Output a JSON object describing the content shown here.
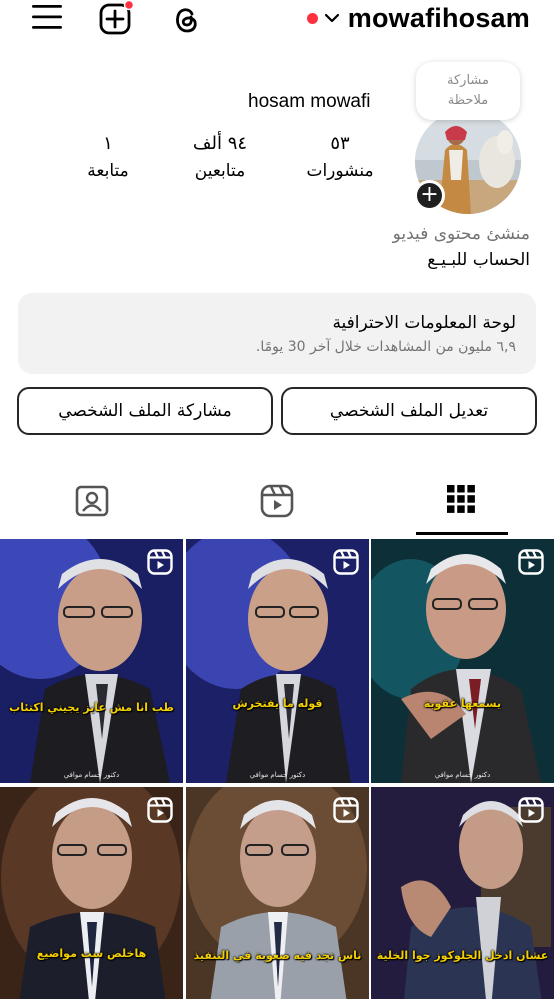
{
  "header": {
    "username": "mowafihosam",
    "accent_red": "#ff3040",
    "icons": [
      "menu-icon",
      "add-post-icon",
      "threads-icon",
      "chevron-down-icon"
    ]
  },
  "profile": {
    "note_bubble": "مشاركة\nملاحظة",
    "display_name": "hosam mowafi",
    "stats": {
      "posts": {
        "value": "٥٣",
        "label": "منشورات"
      },
      "followers": {
        "value": "٩٤ ألف",
        "label": "متابعين"
      },
      "following": {
        "value": "١",
        "label": "متابعة"
      }
    },
    "category": "منشئ محتوى فيديو",
    "bio": "الحساب للبـيـع"
  },
  "dashboard": {
    "title": "لوحة المعلومات الاحترافية",
    "subtitle": "٦,٩ مليون من المشاهدات خلال آخر 30 يومًا."
  },
  "buttons": {
    "edit_profile": "تعديل الملف الشخصي",
    "share_profile": "مشاركة الملف الشخصي"
  },
  "tabs": [
    {
      "name": "grid-icon",
      "active": true
    },
    {
      "name": "reels-icon",
      "active": false
    },
    {
      "name": "tagged-icon",
      "active": false
    }
  ],
  "posts": [
    {
      "caption": "يسمعها عقوبة",
      "signature": "دكتور حسام موافي"
    },
    {
      "caption": "قوله ما يفتخرش",
      "signature": "دكتور حسام موافي"
    },
    {
      "caption": "طب انا مش عايز يجيني اكتئاب",
      "signature": "دكتور حسام موافي"
    },
    {
      "caption": "عشان ادخل الجلوكوز جوا الخلية",
      "signature": ""
    },
    {
      "caption": "ناس تجد فيه صعوبة في التنفيذ",
      "signature": ""
    },
    {
      "caption": "هاخلص ست مواضيع",
      "signature": ""
    }
  ]
}
